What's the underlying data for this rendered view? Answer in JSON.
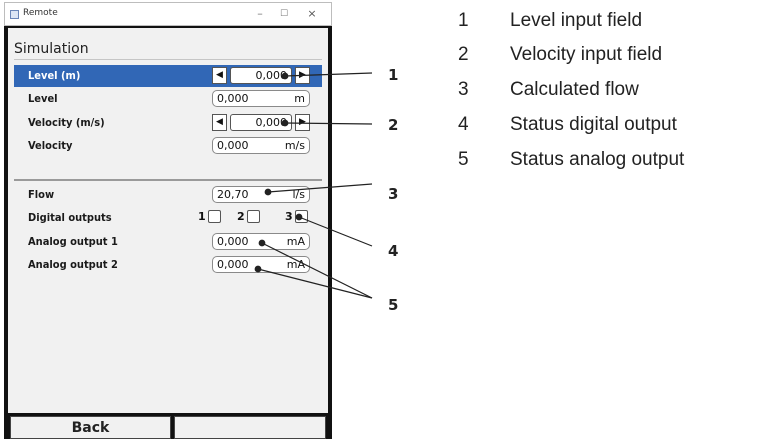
{
  "window": {
    "title": "Remote",
    "min": "–",
    "max": "☐",
    "close": "×"
  },
  "screen": {
    "title": "Simulation",
    "rows": [
      {
        "label": "Level (m)",
        "value": "0,000",
        "left": "◀",
        "right": "▶"
      },
      {
        "label": "Level",
        "value": "0,000",
        "unit": "m"
      },
      {
        "label": "Velocity (m/s)",
        "value": "0,000",
        "left": "◀",
        "right": "▶"
      },
      {
        "label": "Velocity",
        "value": "0,000",
        "unit": "m/s"
      },
      {
        "label": "Flow",
        "value": "20,70",
        "unit": "l/s"
      },
      {
        "label": "Digital outputs",
        "checks": [
          "1",
          "2",
          "3"
        ]
      },
      {
        "label": "Analog output 1",
        "value": "0,000",
        "unit": "mA"
      },
      {
        "label": "Analog output 2",
        "value": "0,000",
        "unit": "mA"
      }
    ],
    "buttons": {
      "back": "Back",
      "right": ""
    }
  },
  "callouts": [
    "1",
    "2",
    "3",
    "4",
    "5"
  ],
  "legend": [
    {
      "num": "1",
      "text": "Level input field"
    },
    {
      "num": "2",
      "text": "Velocity input field"
    },
    {
      "num": "3",
      "text": "Calculated flow"
    },
    {
      "num": "4",
      "text": "Status digital output"
    },
    {
      "num": "5",
      "text": "Status analog output"
    }
  ],
  "colors": {
    "selected_row": "#3167b6",
    "screen_bg": "#f1f1f1",
    "frame": "#111111"
  }
}
